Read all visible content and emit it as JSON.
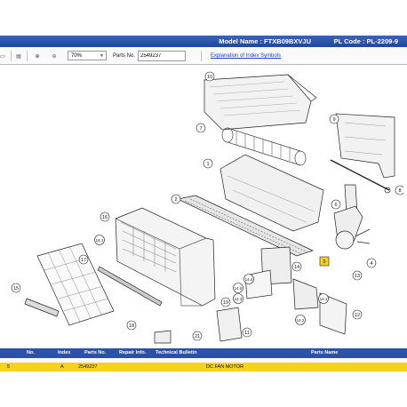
{
  "header": {
    "model_name": "Model Name : FTXB09BXVJU",
    "pl_code": "PL Code : PL-2209-9"
  },
  "toolbar": {
    "zoom_value": "70%",
    "parts_no_label": "Parts No.",
    "parts_no_value": "2549237",
    "explanation_link": "Explanation of Index Symbols"
  },
  "diagram": {
    "callouts": [
      "10",
      "7",
      "1",
      "2",
      "16",
      "16.1",
      "17",
      "15",
      "18",
      "9",
      "8",
      "5",
      "6",
      "4",
      "14",
      "14.1",
      "14.2",
      "14.3",
      "14.4",
      "14.5",
      "11",
      "12",
      "13",
      "19",
      "21"
    ],
    "selected_callout": "5"
  },
  "table": {
    "headers": [
      "No.",
      "Index",
      "Parts No.",
      "Repair Info.",
      "Technical Bulletin",
      "Parts Name"
    ],
    "rows": [
      {
        "no": "5",
        "index": "A",
        "parts_no": "2549237",
        "repair_info": "",
        "technical_bulletin": "",
        "parts_name": "DC FAN MOTOR"
      }
    ]
  },
  "colors": {
    "header_blue": "#1f46a0",
    "selected_row": "#f6d21c",
    "link": "#1a3fbf"
  }
}
